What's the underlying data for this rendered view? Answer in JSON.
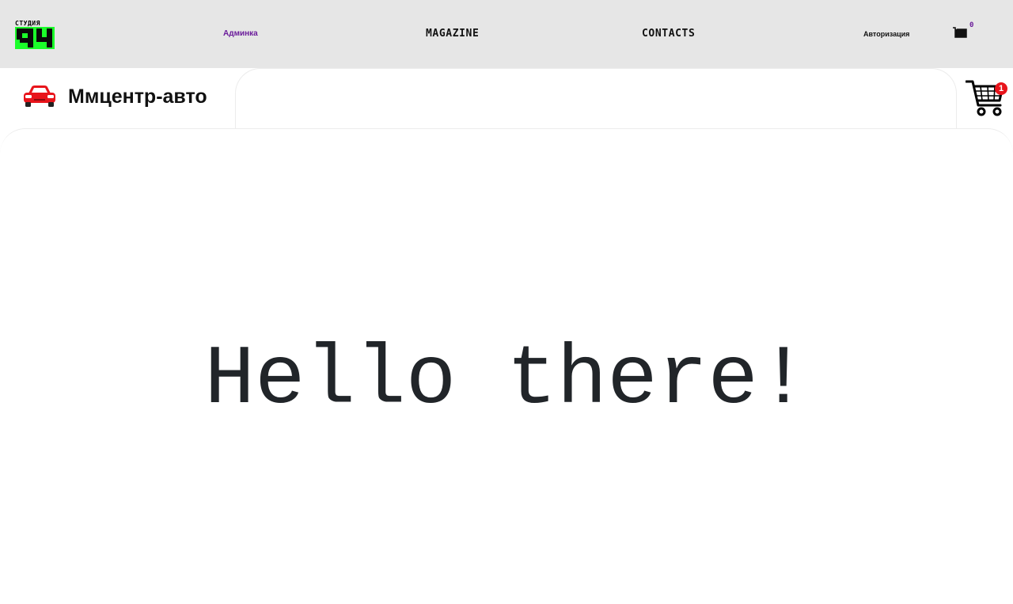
{
  "header": {
    "logo": {
      "top_text": "СТУДИЯ",
      "number": "94",
      "colors": {
        "green": "#1bff2a",
        "black": "#0a0a0a"
      }
    },
    "nav": {
      "admin": "Админка",
      "magazine": "MAGAZINE",
      "contacts": "CONTACTS",
      "auth": "Авторизация"
    },
    "cart_count": "0"
  },
  "brand": {
    "name": "Ммцентр-авто",
    "icon": "car-icon",
    "icon_color": "#e8141b"
  },
  "cart": {
    "icon": "shopping-cart-icon",
    "badge": "1",
    "badge_color": "#e8141b"
  },
  "main": {
    "greeting": "Hello there!"
  }
}
